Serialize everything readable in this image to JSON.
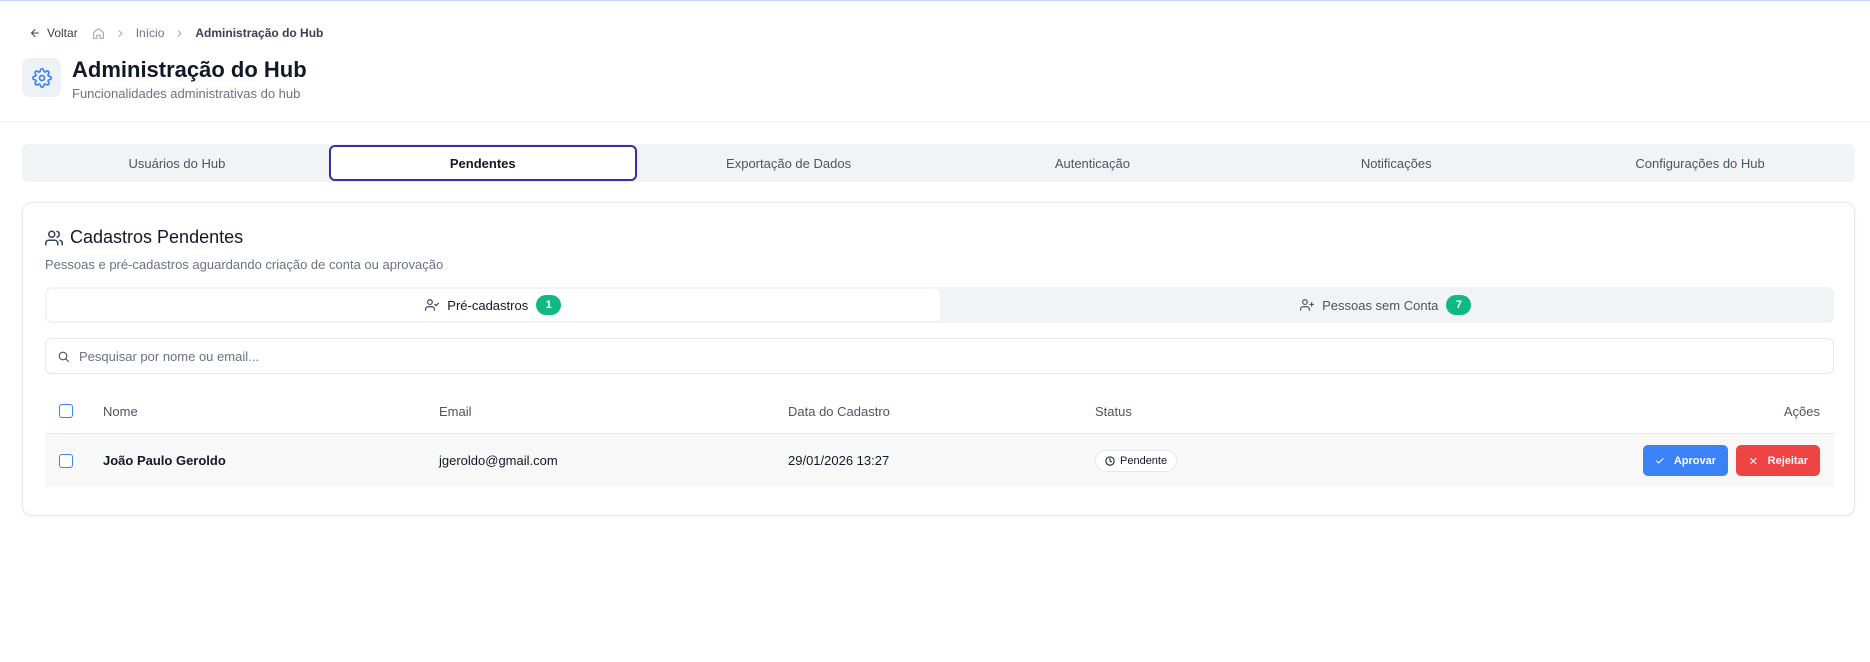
{
  "breadcrumb": {
    "back_label": "Voltar",
    "home_label": "Início",
    "current_label": "Administração do Hub"
  },
  "header": {
    "title": "Administração do Hub",
    "subtitle": "Funcionalidades administrativas do hub",
    "icon": "gear-icon"
  },
  "main_tabs": [
    {
      "label": "Usuários do Hub",
      "active": false
    },
    {
      "label": "Pendentes",
      "active": true
    },
    {
      "label": "Exportação de Dados",
      "active": false
    },
    {
      "label": "Autenticação",
      "active": false
    },
    {
      "label": "Notificações",
      "active": false
    },
    {
      "label": "Configurações do Hub",
      "active": false
    }
  ],
  "card": {
    "title": "Cadastros Pendentes",
    "description": "Pessoas e pré-cadastros aguardando criação de conta ou aprovação",
    "icon": "users-icon"
  },
  "sub_tabs": [
    {
      "label": "Pré-cadastros",
      "count": "1",
      "active": true,
      "icon": "user-check-icon"
    },
    {
      "label": "Pessoas sem Conta",
      "count": "7",
      "active": false,
      "icon": "user-plus-icon"
    }
  ],
  "search": {
    "placeholder": "Pesquisar por nome ou email..."
  },
  "table": {
    "columns": [
      "Nome",
      "Email",
      "Data do Cadastro",
      "Status",
      "Ações"
    ],
    "rows": [
      {
        "name": "João Paulo Geroldo",
        "email": "jgeroldo@gmail.com",
        "date": "29/01/2026 13:27",
        "status": "Pendente",
        "approve_label": "Aprovar",
        "reject_label": "Rejeitar"
      }
    ]
  },
  "colors": {
    "accent": "#3b82f6",
    "active_tab_border": "#3730a3",
    "badge_green": "#10b981",
    "danger": "#ef4444"
  }
}
